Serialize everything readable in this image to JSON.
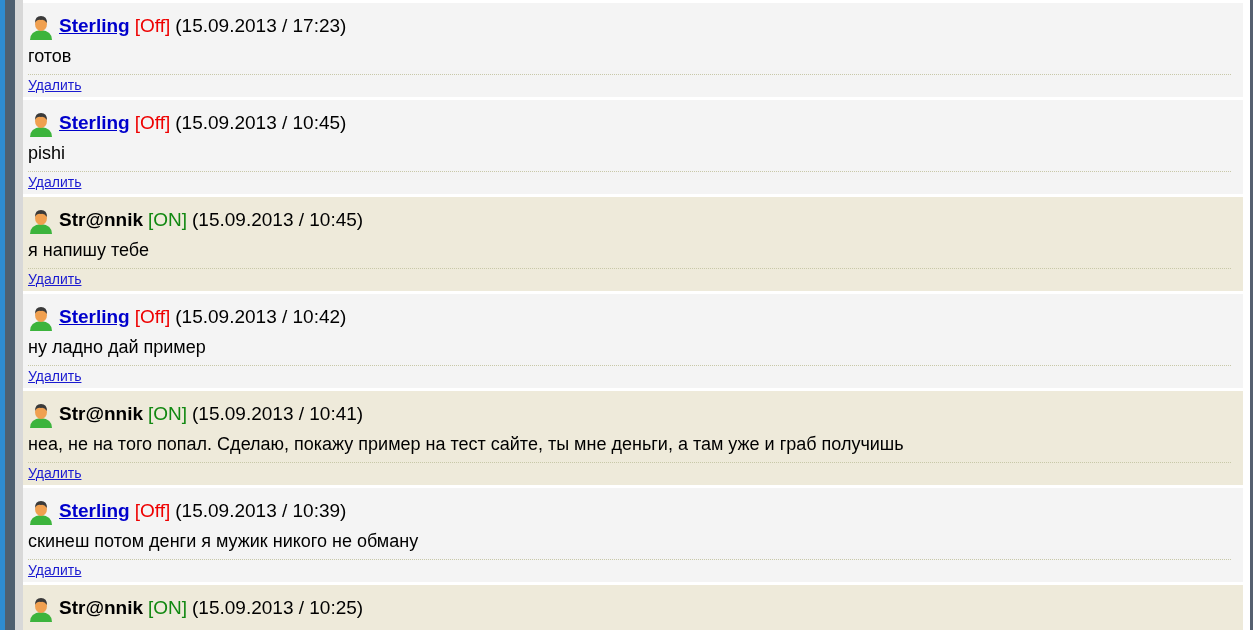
{
  "messages": [
    {
      "kind": "other",
      "author": "Sterling",
      "status": "[Off]",
      "online": false,
      "time": "(15.09.2013 / 17:23)",
      "text": "готов",
      "action": "Удалить"
    },
    {
      "kind": "other",
      "author": "Sterling",
      "status": "[Off]",
      "online": false,
      "time": "(15.09.2013 / 10:45)",
      "text": "pishi",
      "action": "Удалить"
    },
    {
      "kind": "self",
      "author": "Str@nnik",
      "status": "[ON]",
      "online": true,
      "time": "(15.09.2013 / 10:45)",
      "text": "я напишу тебе",
      "action": "Удалить"
    },
    {
      "kind": "other",
      "author": "Sterling",
      "status": "[Off]",
      "online": false,
      "time": "(15.09.2013 / 10:42)",
      "text": "ну ладно дай пример",
      "action": "Удалить"
    },
    {
      "kind": "self",
      "author": "Str@nnik",
      "status": "[ON]",
      "online": true,
      "time": "(15.09.2013 / 10:41)",
      "text": "неа, не на того попал. Сделаю, покажу пример на тест сайте, ты мне деньги, а там уже и граб получишь",
      "action": "Удалить"
    },
    {
      "kind": "other",
      "author": "Sterling",
      "status": "[Off]",
      "online": false,
      "time": "(15.09.2013 / 10:39)",
      "text": "скинеш потом денги я мужик никого не обману",
      "action": "Удалить"
    },
    {
      "kind": "self",
      "author": "Str@nnik",
      "status": "[ON]",
      "online": true,
      "time": "(15.09.2013 / 10:25)"
    }
  ]
}
